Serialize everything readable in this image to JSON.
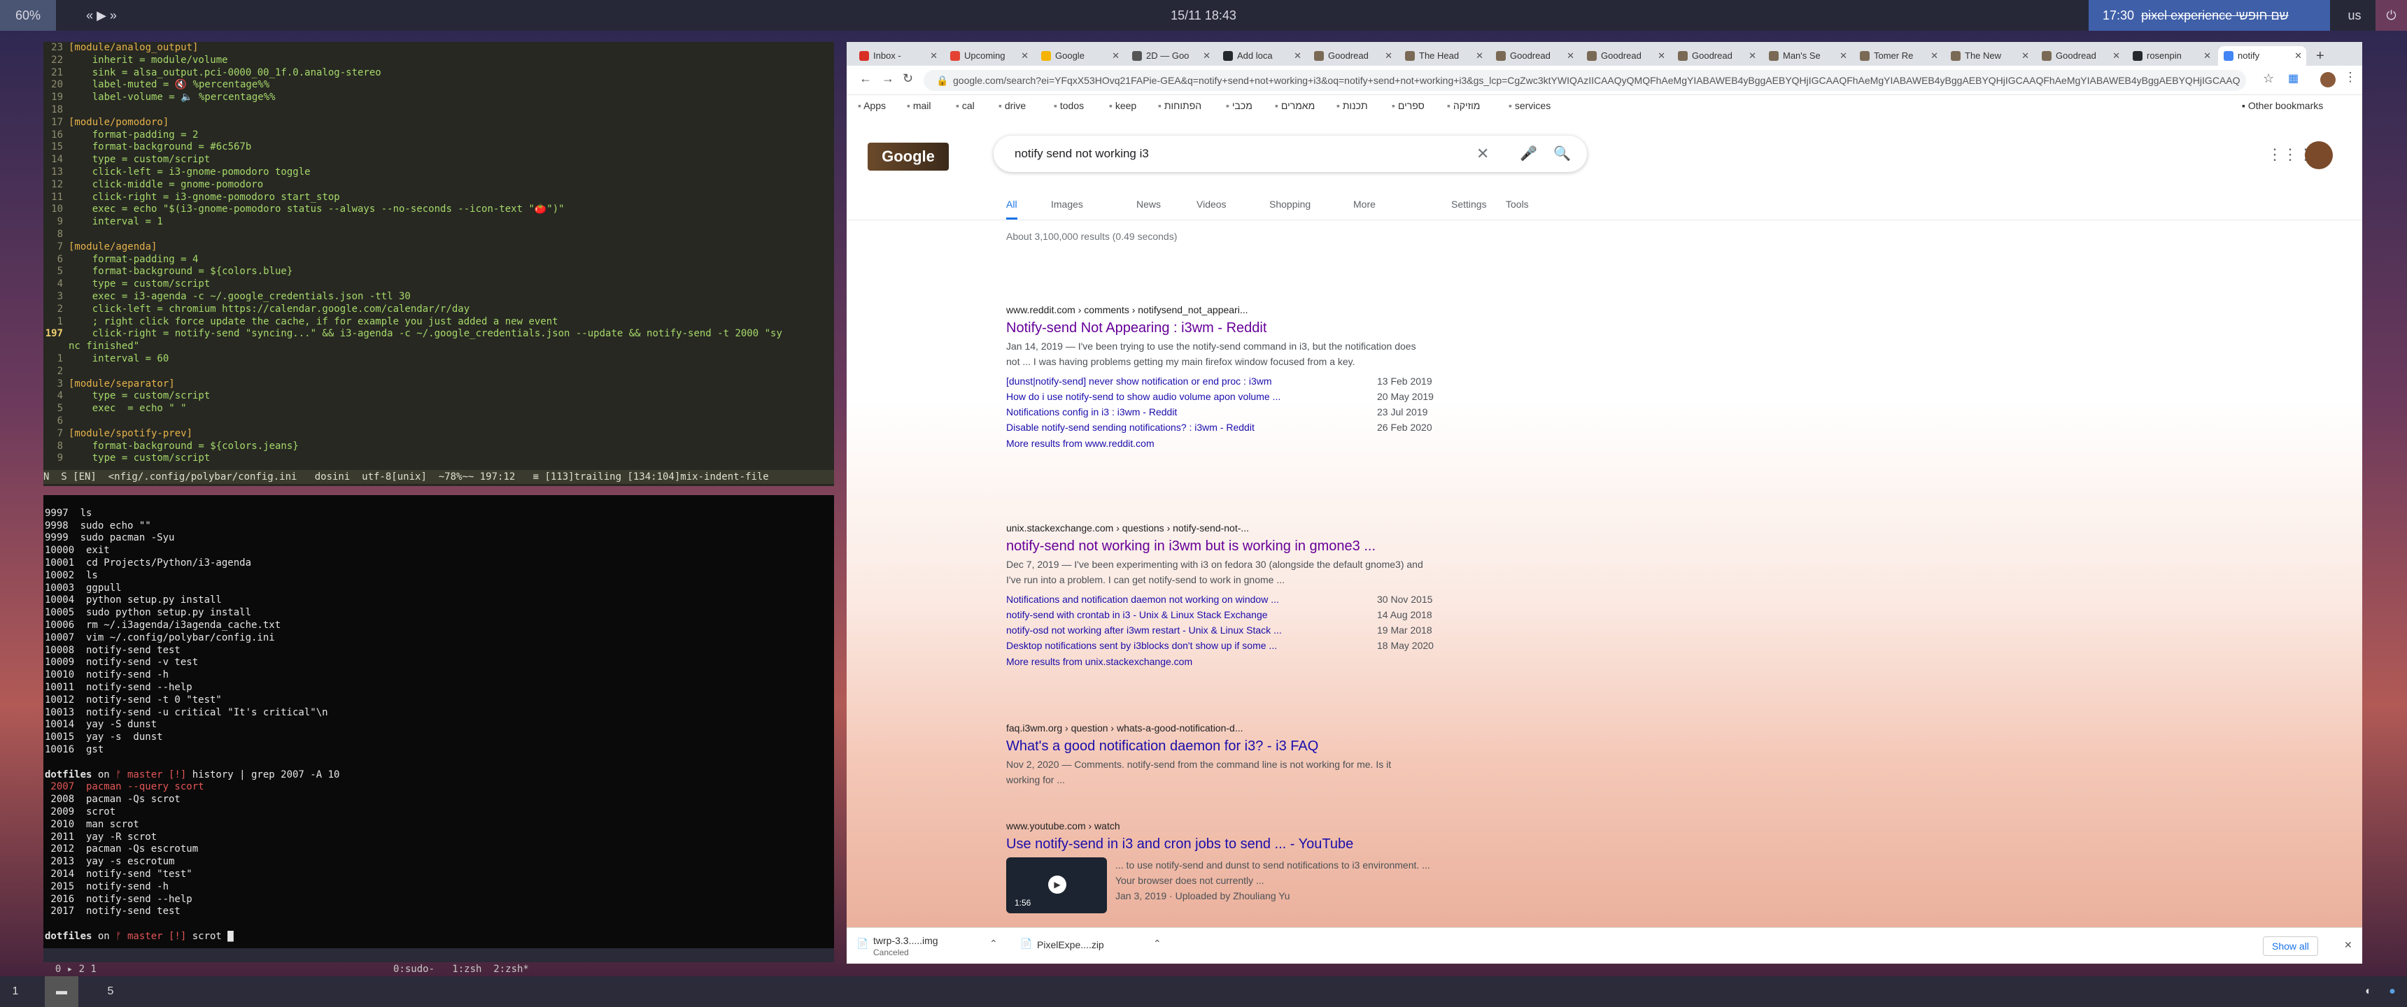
{
  "topbar": {
    "battery": "60%",
    "media": "« ▶ »",
    "clock": "15/11 18:43",
    "pomodoro": "17:30",
    "pomodoro_task": "pixel experience שם חופשי",
    "layout": "us",
    "power": "⏻"
  },
  "bottombar": {
    "workspaces": [
      "1",
      "",
      "5"
    ]
  },
  "editor": {
    "lines": [
      {
        "n": "23",
        "t": "[module/analog_output]",
        "cls": "sec"
      },
      {
        "n": "22",
        "t": "    inherit = module/volume"
      },
      {
        "n": "21",
        "t": "    sink = alsa_output.pci-0000_00_1f.0.analog-stereo"
      },
      {
        "n": "20",
        "t": "    label-muted = 🔇 %percentage%%"
      },
      {
        "n": "19",
        "t": "    label-volume = 🔈 %percentage%%"
      },
      {
        "n": "18",
        "t": ""
      },
      {
        "n": "17",
        "t": "[module/pomodoro]",
        "cls": "sec"
      },
      {
        "n": "16",
        "t": "    format-padding = 2"
      },
      {
        "n": "15",
        "t": "    format-background = #6c567b"
      },
      {
        "n": "14",
        "t": "    type = custom/script"
      },
      {
        "n": "13",
        "t": "    click-left = i3-gnome-pomodoro toggle"
      },
      {
        "n": "12",
        "t": "    click-middle = gnome-pomodoro"
      },
      {
        "n": "11",
        "t": "    click-right = i3-gnome-pomodoro start_stop"
      },
      {
        "n": "10",
        "t": "    exec = echo \"$(i3-gnome-pomodoro status --always --no-seconds --icon-text \"🍅\")\""
      },
      {
        "n": "9",
        "t": "    interval = 1"
      },
      {
        "n": "8",
        "t": ""
      },
      {
        "n": "7",
        "t": "[module/agenda]",
        "cls": "sec"
      },
      {
        "n": "6",
        "t": "    format-padding = 4"
      },
      {
        "n": "5",
        "t": "    format-background = ${colors.blue}"
      },
      {
        "n": "4",
        "t": "    type = custom/script"
      },
      {
        "n": "3",
        "t": "    exec = i3-agenda -c ~/.google_credentials.json -ttl 30"
      },
      {
        "n": "2",
        "t": "    click-left = chromium https://calendar.google.com/calendar/r/day"
      },
      {
        "n": "1",
        "t": "    ; right click force update the cache, if for example you just added a new event"
      },
      {
        "n": "197",
        "t": "    click-right = notify-send \"syncing...\" && i3-agenda -c ~/.google_credentials.json --update && notify-send -t 2000 \"sy",
        "cur": true
      },
      {
        "n": "",
        "t": "nc finished\""
      },
      {
        "n": "1",
        "t": "    interval = 60"
      },
      {
        "n": "2",
        "t": ""
      },
      {
        "n": "3",
        "t": "[module/separator]",
        "cls": "sec"
      },
      {
        "n": "4",
        "t": "    type = custom/script"
      },
      {
        "n": "5",
        "t": "    exec  = echo \" \""
      },
      {
        "n": "6",
        "t": ""
      },
      {
        "n": "7",
        "t": "[module/spotify-prev]",
        "cls": "sec"
      },
      {
        "n": "8",
        "t": "    format-background = ${colors.jeans}"
      },
      {
        "n": "9",
        "t": "    type = custom/script"
      }
    ],
    "statusline": "N  S [EN]  <nfig/.config/polybar/config.ini   dosini  utf-8[unix]  ~78%~~ 197:12   ≡ [113]trailing [134:104]mix-indent-file"
  },
  "terminal": {
    "history": [
      "9997  ls",
      "9998  sudo echo \"\"",
      "9999  sudo pacman -Syu",
      "10000  exit",
      "10001  cd Projects/Python/i3-agenda",
      "10002  ls",
      "10003  ggpull",
      "10004  python setup.py install",
      "10005  sudo python setup.py install",
      "10006  rm ~/.i3agenda/i3agenda_cache.txt",
      "10007  vim ~/.config/polybar/config.ini",
      "10008  notify-send test",
      "10009  notify-send -v test",
      "10010  notify-send -h",
      "10011  notify-send --help",
      "10012  notify-send -t 0 \"test\"",
      "10013  notify-send -u critical \"It's critical\"\\n",
      "10014  yay -S dunst",
      "10015  yay -s  dunst",
      "10016  gst"
    ],
    "prompt1": {
      "dir": "dotfiles",
      "on": " on ",
      "branch": "ᚠ master",
      "flag": " [!]",
      "cmd": " history | grep 2007 -A 10"
    },
    "grep": [
      " 2007  pacman --query scort",
      " 2008  pacman -Qs scrot",
      " 2009  scrot",
      " 2010  man scrot",
      " 2011  yay -R scrot",
      " 2012  pacman -Qs escrotum",
      " 2013  yay -s escrotum",
      " 2014  notify-send \"test\"",
      " 2015  notify-send -h",
      " 2016  notify-send --help",
      " 2017  notify-send test"
    ],
    "prompt2": {
      "dir": "dotfiles",
      "on": " on ",
      "branch": "ᚠ master",
      "flag": " [!]",
      "cmd": " scrot "
    },
    "tmux": {
      "left": "0 ▸ 2 1",
      "windows": "0:sudo-   1:zsh  2:zsh*"
    }
  },
  "browser": {
    "tabs": [
      {
        "label": "Inbox -",
        "color": "#d93025"
      },
      {
        "label": "Upcoming",
        "color": "#e44232"
      },
      {
        "label": "Google",
        "color": "#f4b400"
      },
      {
        "label": "2D — Goo",
        "color": "#555"
      },
      {
        "label": "Add loca",
        "color": "#24292e"
      },
      {
        "label": "Goodread",
        "color": "#7a6a55"
      },
      {
        "label": "The Head",
        "color": "#7a6a55"
      },
      {
        "label": "Goodread",
        "color": "#7a6a55"
      },
      {
        "label": "Goodread",
        "color": "#7a6a55"
      },
      {
        "label": "Goodread",
        "color": "#7a6a55"
      },
      {
        "label": "Man's Se",
        "color": "#7a6a55"
      },
      {
        "label": "Tomer Re",
        "color": "#7a6a55"
      },
      {
        "label": "The New",
        "color": "#7a6a55"
      },
      {
        "label": "Goodread",
        "color": "#7a6a55"
      },
      {
        "label": "rosenpin",
        "color": "#24292e"
      },
      {
        "label": "notify",
        "color": "#4285f4",
        "active": true
      }
    ],
    "url": "google.com/search?ei=YFqxX53HOvq21FAPie-GEA&q=notify+send+not+working+i3&oq=notify+send+not+working+i3&gs_lcp=CgZwc3ktYWIQAzIICAAQyQMQFhAeMgYIABAWEB4yBggAEBYQHjIGCAAQFhAeMgYIABAWEB4yBggAEBYQHjIGCAAQFhAeMgYIABAWEB4yBggAEBYQHjIGCAAQ",
    "bookmarks": [
      "Apps",
      "mail",
      "cal",
      "drive",
      "todos",
      "keep",
      "הפתוחות",
      "מכבי",
      "מאמרים",
      "תכנות",
      "ספרים",
      "מוזיקה",
      "services"
    ],
    "other_bookmarks": "Other bookmarks",
    "search_query": "notify send not working i3",
    "logo": "Google",
    "gtabs": [
      "All",
      "Images",
      "News",
      "Videos",
      "Shopping",
      "More",
      "Settings",
      "Tools"
    ],
    "stats": "About 3,100,000 results (0.49 seconds)",
    "results": [
      {
        "url": "www.reddit.com › comments › notifysend_not_appeari...",
        "title": "Notify-send Not Appearing : i3wm - Reddit",
        "snippet": [
          "Jan 14, 2019 — I've been trying to use the notify-send command in i3, but the notification does",
          "not ... I was having problems getting my main firefox window focused from a key."
        ],
        "subs": [
          {
            "t": "[dunst|notify-send] never show notification or end proc : i3wm",
            "d": "13 Feb 2019"
          },
          {
            "t": "How do i use notify-send to show audio volume apon volume ...",
            "d": "20 May 2019"
          },
          {
            "t": "Notifications config in i3 : i3wm - Reddit",
            "d": "23 Jul 2019"
          },
          {
            "t": "Disable notify-send sending notifications? : i3wm - Reddit",
            "d": "26 Feb 2020"
          }
        ],
        "more": "More results from www.reddit.com"
      },
      {
        "url": "unix.stackexchange.com › questions › notify-send-not-...",
        "title": "notify-send not working in i3wm but is working in gmone3 ...",
        "snippet": [
          "Dec 7, 2019 — I've been experimenting with i3 on fedora 30 (alongside the default gnome3) and",
          "I've run into a problem. I can get notify-send to work in gnome ..."
        ],
        "subs": [
          {
            "t": "Notifications and notification daemon not working on window ...",
            "d": "30 Nov 2015"
          },
          {
            "t": "notify-send with crontab in i3 - Unix & Linux Stack Exchange",
            "d": "14 Aug 2018"
          },
          {
            "t": "notify-osd not working after i3wm restart - Unix & Linux Stack ...",
            "d": "19 Mar 2018"
          },
          {
            "t": "Desktop notifications sent by i3blocks don't show up if some ...",
            "d": "18 May 2020"
          }
        ],
        "more": "More results from unix.stackexchange.com"
      },
      {
        "url": "faq.i3wm.org › question › whats-a-good-notification-d...",
        "title": "What's a good notification daemon for i3? - i3 FAQ",
        "snippet": [
          "Nov 2, 2020 — Comments. notify-send from the command line is not working for me. Is it",
          "working for ..."
        ],
        "subs": [],
        "more": ""
      },
      {
        "url": "www.youtube.com › watch",
        "title": "Use notify-send in i3 and cron jobs to send ... - YouTube",
        "snippet": [
          "... to use notify-send and dunst to send notifications to i3 environment. ...",
          "Your browser does not currently ...",
          "Jan 3, 2019 · Uploaded by Zhouliang Yu"
        ],
        "subs": [],
        "more": "",
        "video": "1:56"
      }
    ],
    "downloads": [
      {
        "name": "twrp-3.3.....img",
        "status": "Canceled"
      },
      {
        "name": "PixelExpe....zip",
        "status": ""
      }
    ],
    "show_all": "Show all"
  }
}
